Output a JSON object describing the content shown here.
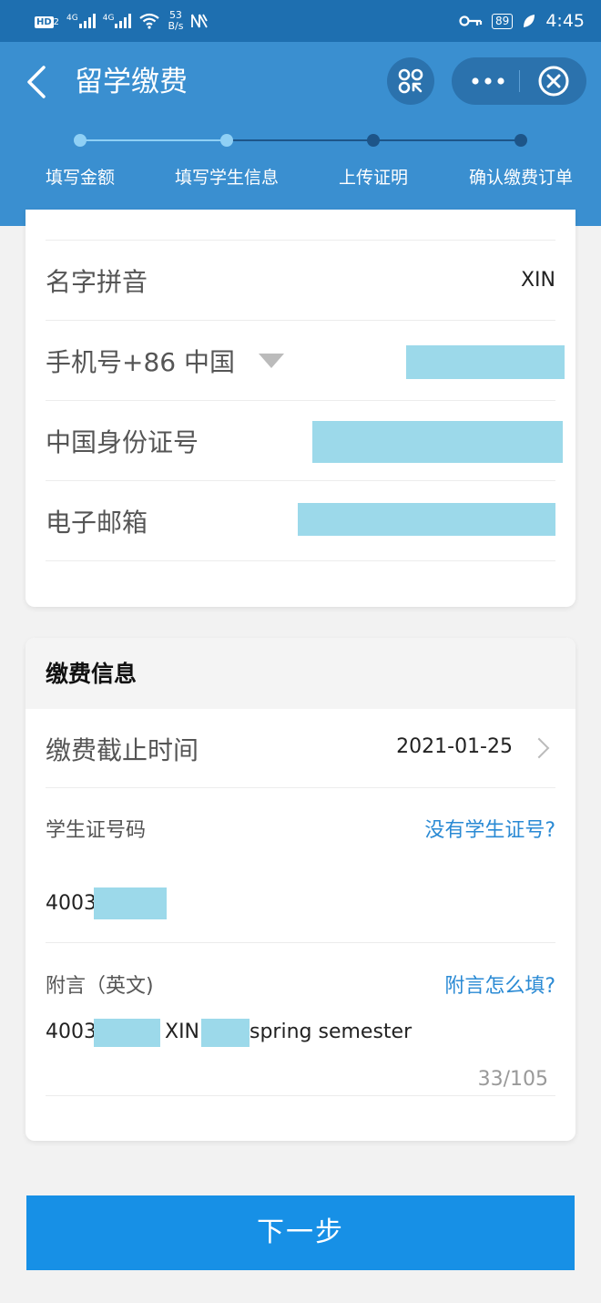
{
  "status_bar": {
    "hd_label": "HD",
    "hd_sub": "2",
    "net1": "4G",
    "net2": "4G",
    "speed_value": "53",
    "speed_unit": "B/s",
    "battery": "89",
    "time": "4:45"
  },
  "header": {
    "title": "留学缴费",
    "steps": [
      "填写金额",
      "填写学生信息",
      "上传证明",
      "确认缴费订单"
    ],
    "current_step_index": 1
  },
  "student_info": {
    "name_pinyin_label": "名字拼音",
    "name_pinyin_value": "XIN",
    "phone_label": "手机号+86 中国",
    "id_label": "中国身份证号",
    "email_label": "电子邮箱"
  },
  "payment_info": {
    "section_title": "缴费信息",
    "deadline_label": "缴费截止时间",
    "deadline_value": "2021-01-25",
    "student_no_label": "学生证号码",
    "no_student_no_link": "没有学生证号?",
    "student_no_prefix": "4003",
    "remark_label": "附言（英文)",
    "remark_help_link": "附言怎么填?",
    "remark_part1": "4003",
    "remark_part2": "XIN",
    "remark_part3": "spring semester",
    "remark_counter": "33/105"
  },
  "next_button": "下一步",
  "colors": {
    "header_bg": "#3a8fd0",
    "status_bg": "#1e6fb0",
    "accent_link": "#2a8ad4",
    "button_bg": "#1790e6",
    "redaction": "#9cd9ea"
  }
}
